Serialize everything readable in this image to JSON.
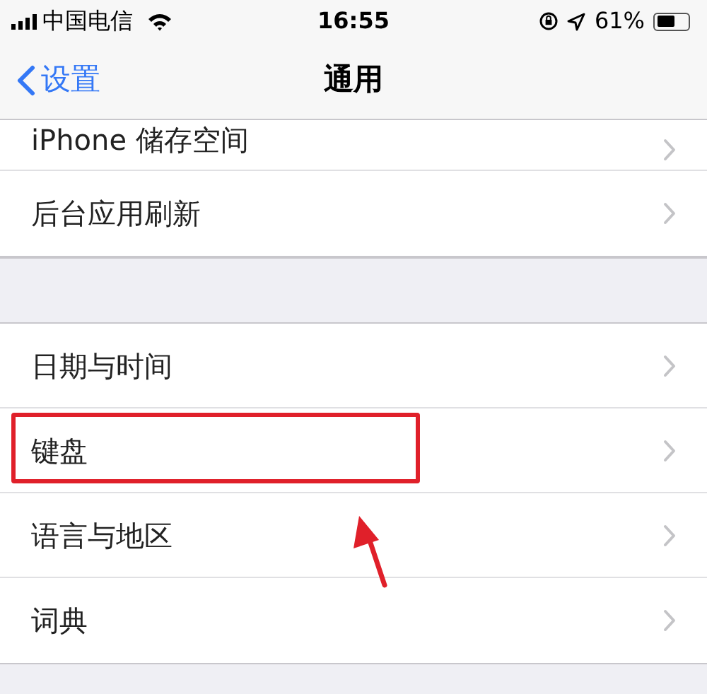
{
  "status_bar": {
    "carrier": "中国电信",
    "time": "16:55",
    "battery": "61%"
  },
  "nav_bar": {
    "back": "设置",
    "title": "通用"
  },
  "groups": [
    [
      {
        "label": "iPhone 储存空间",
        "annotated": false
      },
      {
        "label": "后台应用刷新",
        "annotated": false
      }
    ],
    [
      {
        "label": "日期与时间",
        "annotated": false
      },
      {
        "label": "键盘",
        "annotated": true
      },
      {
        "label": "语言与地区",
        "annotated": false
      },
      {
        "label": "词典",
        "annotated": false
      }
    ]
  ]
}
